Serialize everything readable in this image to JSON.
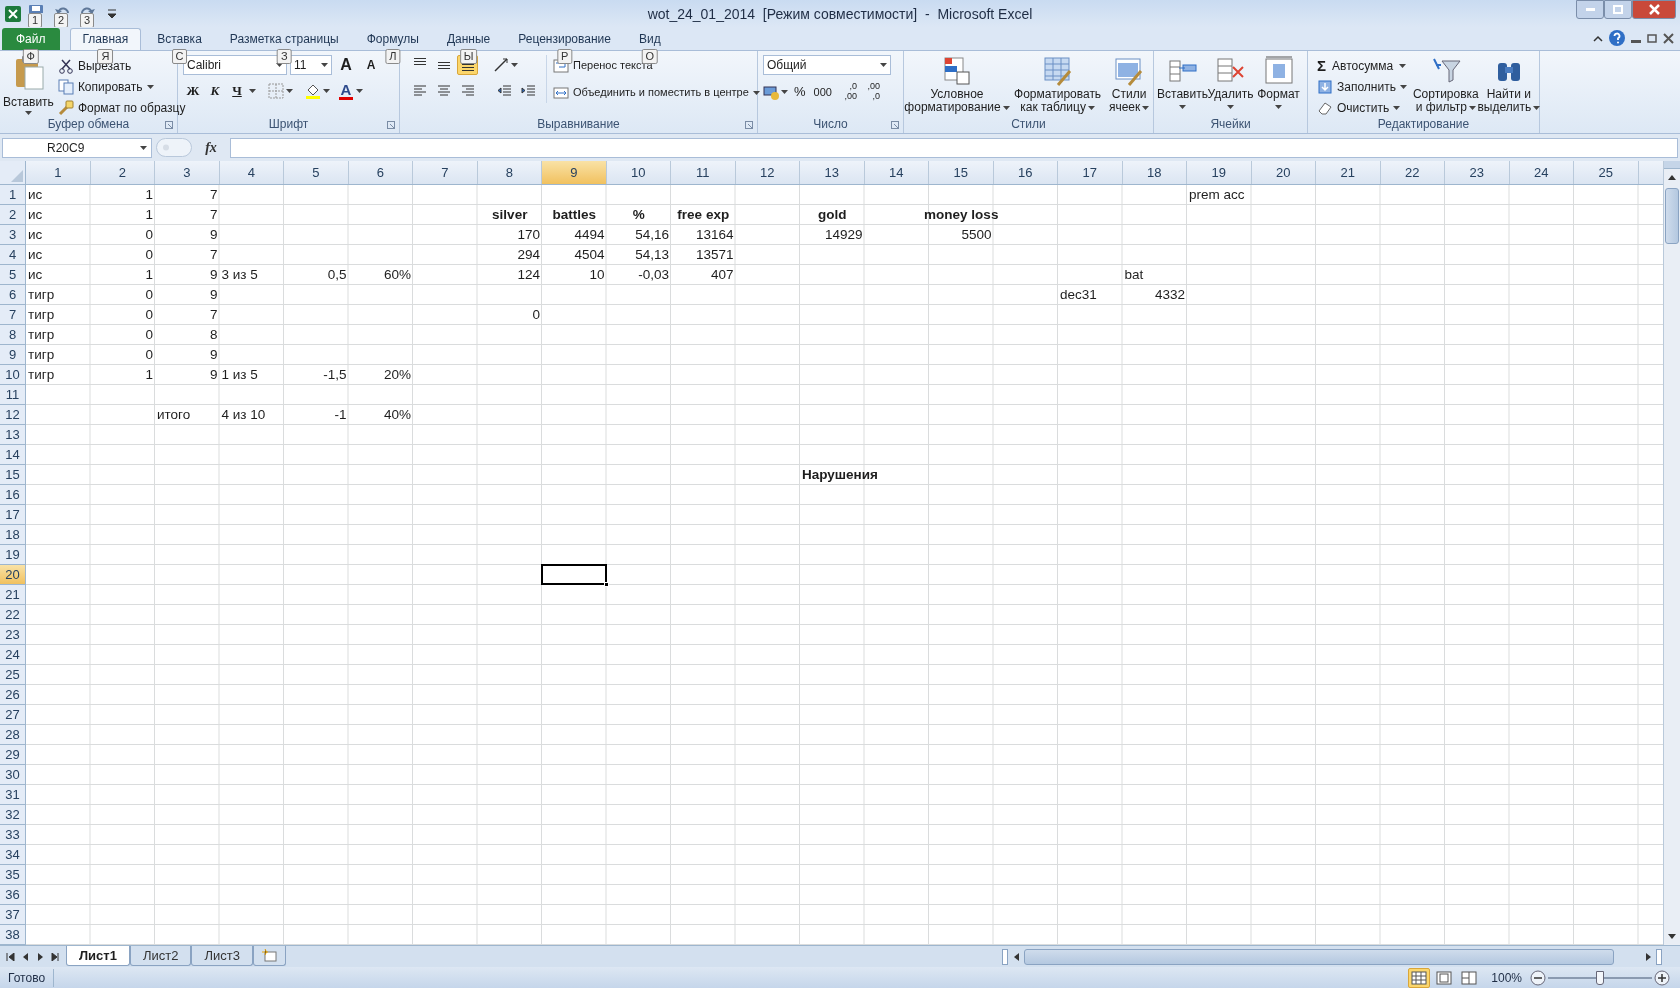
{
  "window": {
    "title": "wot_24_01_2014  [Режим совместимости]  -  Microsoft Excel"
  },
  "quick_access_keytips": [
    "1",
    "2",
    "3"
  ],
  "tabs": [
    {
      "label": "Файл",
      "keytip": "Ф",
      "kind": "file",
      "selected": false
    },
    {
      "label": "Главная",
      "keytip": "Я",
      "kind": "tab",
      "selected": true
    },
    {
      "label": "Вставка",
      "keytip": "С",
      "kind": "tab",
      "selected": false
    },
    {
      "label": "Разметка страницы",
      "keytip": "З",
      "kind": "tab",
      "selected": false
    },
    {
      "label": "Формулы",
      "keytip": "Л",
      "kind": "tab",
      "selected": false
    },
    {
      "label": "Данные",
      "keytip": "Ы",
      "kind": "tab",
      "selected": false
    },
    {
      "label": "Рецензирование",
      "keytip": "Р",
      "kind": "tab",
      "selected": false
    },
    {
      "label": "Вид",
      "keytip": "О",
      "kind": "tab",
      "selected": false
    }
  ],
  "ribbon": {
    "clipboard": {
      "label": "Буфер обмена",
      "paste": "Вставить",
      "items": [
        "Вырезать",
        "Копировать",
        "Формат по образцу"
      ]
    },
    "font": {
      "label": "Шрифт",
      "name": "Calibri",
      "size": "11",
      "grow": "A",
      "shrink": "A",
      "bold": "Ж",
      "italic": "К",
      "underline": "Ч",
      "color_button": "A"
    },
    "alignment": {
      "label": "Выравнивание",
      "vertical": [
        {
          "selected": false
        },
        {
          "selected": false
        },
        {
          "selected": true
        }
      ],
      "wrap": "Перенос текста",
      "merge": "Объединить и поместить в центре"
    },
    "number": {
      "label": "Число",
      "format": "Общий",
      "percent": "%",
      "thousands": "000",
      "decimals": [
        {
          "top": ",0",
          "bottom": ",00"
        },
        {
          "top": ",00",
          "bottom": ",0"
        }
      ]
    },
    "styles": {
      "label": "Стили",
      "buttons": [
        {
          "lines": [
            "Условное",
            "форматирование"
          ]
        },
        {
          "lines": [
            "Форматировать",
            "как таблицу"
          ]
        },
        {
          "lines": [
            "Стили",
            "ячеек"
          ]
        }
      ]
    },
    "cells": {
      "label": "Ячейки",
      "buttons": [
        "Вставить",
        "Удалить",
        "Формат"
      ]
    },
    "editing": {
      "label": "Редактирование",
      "sum_icon": "Σ",
      "small": [
        "Автосумма",
        "Заполнить",
        "Очистить"
      ],
      "big": [
        {
          "lines": [
            "Сортировка",
            "и фильтр"
          ]
        },
        {
          "lines": [
            "Найти и",
            "выделить"
          ]
        }
      ]
    }
  },
  "formula_bar": {
    "name_box": "R20C9",
    "fx": "fx"
  },
  "columns": [
    {
      "label": "1",
      "selected": false
    },
    {
      "label": "2",
      "selected": false
    },
    {
      "label": "3",
      "selected": false
    },
    {
      "label": "4",
      "selected": false
    },
    {
      "label": "5",
      "selected": false
    },
    {
      "label": "6",
      "selected": false
    },
    {
      "label": "7",
      "selected": false
    },
    {
      "label": "8",
      "selected": false
    },
    {
      "label": "9",
      "selected": true
    },
    {
      "label": "10",
      "selected": false
    },
    {
      "label": "11",
      "selected": false
    },
    {
      "label": "12",
      "selected": false
    },
    {
      "label": "13",
      "selected": false
    },
    {
      "label": "14",
      "selected": false
    },
    {
      "label": "15",
      "selected": false
    },
    {
      "label": "16",
      "selected": false
    },
    {
      "label": "17",
      "selected": false
    },
    {
      "label": "18",
      "selected": false
    },
    {
      "label": "19",
      "selected": false
    },
    {
      "label": "20",
      "selected": false
    },
    {
      "label": "21",
      "selected": false
    },
    {
      "label": "22",
      "selected": false
    },
    {
      "label": "23",
      "selected": false
    },
    {
      "label": "24",
      "selected": false
    },
    {
      "label": "25",
      "selected": false
    }
  ],
  "rows": [
    {
      "header": "1",
      "selected": false,
      "cells": [
        {
          "text": "ис",
          "kind": "text"
        },
        {
          "text": "1",
          "kind": "number"
        },
        {
          "text": "7",
          "kind": "number"
        },
        null,
        null,
        null,
        null,
        null,
        null,
        null,
        null,
        null,
        null,
        null,
        null,
        null,
        null,
        null,
        {
          "text": "prem acc",
          "kind": "text"
        }
      ]
    },
    {
      "header": "2",
      "selected": false,
      "cells": [
        {
          "text": "ис",
          "kind": "text"
        },
        {
          "text": "1",
          "kind": "number"
        },
        {
          "text": "7",
          "kind": "number"
        },
        null,
        null,
        null,
        null,
        {
          "text": "silver",
          "kind": "heading"
        },
        {
          "text": "battles",
          "kind": "heading"
        },
        {
          "text": "%",
          "kind": "heading"
        },
        {
          "text": "free exp",
          "kind": "heading"
        },
        null,
        {
          "text": "gold",
          "kind": "heading"
        },
        null,
        {
          "text": "money loss",
          "kind": "heading"
        }
      ]
    },
    {
      "header": "3",
      "selected": false,
      "cells": [
        {
          "text": "ис",
          "kind": "text"
        },
        {
          "text": "0",
          "kind": "number"
        },
        {
          "text": "9",
          "kind": "number"
        },
        null,
        null,
        null,
        null,
        {
          "text": "170",
          "kind": "number"
        },
        {
          "text": "4494",
          "kind": "number"
        },
        {
          "text": "54,16",
          "kind": "number"
        },
        {
          "text": "13164",
          "kind": "number"
        },
        null,
        {
          "text": "14929",
          "kind": "number"
        },
        null,
        {
          "text": "5500",
          "kind": "number"
        }
      ]
    },
    {
      "header": "4",
      "selected": false,
      "cells": [
        {
          "text": "ис",
          "kind": "text"
        },
        {
          "text": "0",
          "kind": "number"
        },
        {
          "text": "7",
          "kind": "number"
        },
        null,
        null,
        null,
        null,
        {
          "text": "294",
          "kind": "number"
        },
        {
          "text": "4504",
          "kind": "number"
        },
        {
          "text": "54,13",
          "kind": "number"
        },
        {
          "text": "13571",
          "kind": "number"
        }
      ]
    },
    {
      "header": "5",
      "selected": false,
      "cells": [
        {
          "text": "ис",
          "kind": "text"
        },
        {
          "text": "1",
          "kind": "number"
        },
        {
          "text": "9",
          "kind": "number"
        },
        {
          "text": "3 из 5",
          "kind": "text"
        },
        {
          "text": "0,5",
          "kind": "number"
        },
        {
          "text": "60%",
          "kind": "number"
        },
        null,
        {
          "text": "124",
          "kind": "number"
        },
        {
          "text": "10",
          "kind": "number"
        },
        {
          "text": "-0,03",
          "kind": "number"
        },
        {
          "text": "407",
          "kind": "number"
        },
        null,
        null,
        null,
        null,
        null,
        null,
        {
          "text": "bat",
          "kind": "text"
        }
      ]
    },
    {
      "header": "6",
      "selected": false,
      "cells": [
        {
          "text": "тигр",
          "kind": "text"
        },
        {
          "text": "0",
          "kind": "number"
        },
        {
          "text": "9",
          "kind": "number"
        },
        null,
        null,
        null,
        null,
        null,
        null,
        null,
        null,
        null,
        null,
        null,
        null,
        null,
        {
          "text": "dec31",
          "kind": "text"
        },
        {
          "text": "4332",
          "kind": "number"
        }
      ]
    },
    {
      "header": "7",
      "selected": false,
      "cells": [
        {
          "text": "тигр",
          "kind": "text"
        },
        {
          "text": "0",
          "kind": "number"
        },
        {
          "text": "7",
          "kind": "number"
        },
        null,
        null,
        null,
        null,
        {
          "text": "0",
          "kind": "number"
        }
      ]
    },
    {
      "header": "8",
      "selected": false,
      "cells": [
        {
          "text": "тигр",
          "kind": "text"
        },
        {
          "text": "0",
          "kind": "number"
        },
        {
          "text": "8",
          "kind": "number"
        }
      ]
    },
    {
      "header": "9",
      "selected": false,
      "cells": [
        {
          "text": "тигр",
          "kind": "text"
        },
        {
          "text": "0",
          "kind": "number"
        },
        {
          "text": "9",
          "kind": "number"
        }
      ]
    },
    {
      "header": "10",
      "selected": false,
      "cells": [
        {
          "text": "тигр",
          "kind": "text"
        },
        {
          "text": "1",
          "kind": "number"
        },
        {
          "text": "9",
          "kind": "number"
        },
        {
          "text": "1 из 5",
          "kind": "text"
        },
        {
          "text": "-1,5",
          "kind": "number"
        },
        {
          "text": "20%",
          "kind": "number"
        }
      ]
    },
    {
      "header": "11",
      "selected": false
    },
    {
      "header": "12",
      "selected": false,
      "cells": [
        null,
        null,
        {
          "text": "итого",
          "kind": "text"
        },
        {
          "text": "4 из 10",
          "kind": "text"
        },
        {
          "text": "-1",
          "kind": "number"
        },
        {
          "text": "40%",
          "kind": "number"
        }
      ]
    },
    {
      "header": "13",
      "selected": false
    },
    {
      "header": "14",
      "selected": false
    },
    {
      "header": "15",
      "selected": false,
      "cells": [
        null,
        null,
        null,
        null,
        null,
        null,
        null,
        null,
        null,
        null,
        null,
        null,
        {
          "text": "Нарушения",
          "kind": "note"
        }
      ]
    },
    {
      "header": "16",
      "selected": false
    },
    {
      "header": "17",
      "selected": false
    },
    {
      "header": "18",
      "selected": false
    },
    {
      "header": "19",
      "selected": false
    },
    {
      "header": "20",
      "selected": true
    },
    {
      "header": "21",
      "selected": false
    },
    {
      "header": "22",
      "selected": false
    },
    {
      "header": "23",
      "selected": false
    },
    {
      "header": "24",
      "selected": false
    },
    {
      "header": "25",
      "selected": false
    },
    {
      "header": "26",
      "selected": false
    },
    {
      "header": "27",
      "selected": false
    },
    {
      "header": "28",
      "selected": false
    },
    {
      "header": "29",
      "selected": false
    },
    {
      "header": "30",
      "selected": false
    },
    {
      "header": "31",
      "selected": false
    },
    {
      "header": "32",
      "selected": false
    },
    {
      "header": "33",
      "selected": false
    },
    {
      "header": "34",
      "selected": false
    },
    {
      "header": "35",
      "selected": false
    },
    {
      "header": "36",
      "selected": false
    },
    {
      "header": "37",
      "selected": false
    },
    {
      "header": "38",
      "selected": false
    }
  ],
  "sheet_tabs": [
    {
      "label": "Лист1",
      "selected": true
    },
    {
      "label": "Лист2",
      "selected": false
    },
    {
      "label": "Лист3",
      "selected": false
    }
  ],
  "status_bar": {
    "text": "Готово",
    "views": [
      {
        "kind": "normal",
        "selected": true
      },
      {
        "kind": "layout",
        "selected": false
      },
      {
        "kind": "pagebreak",
        "selected": false
      }
    ],
    "zoom": "100%",
    "zoom_slider": {
      "level": 0.5
    }
  }
}
